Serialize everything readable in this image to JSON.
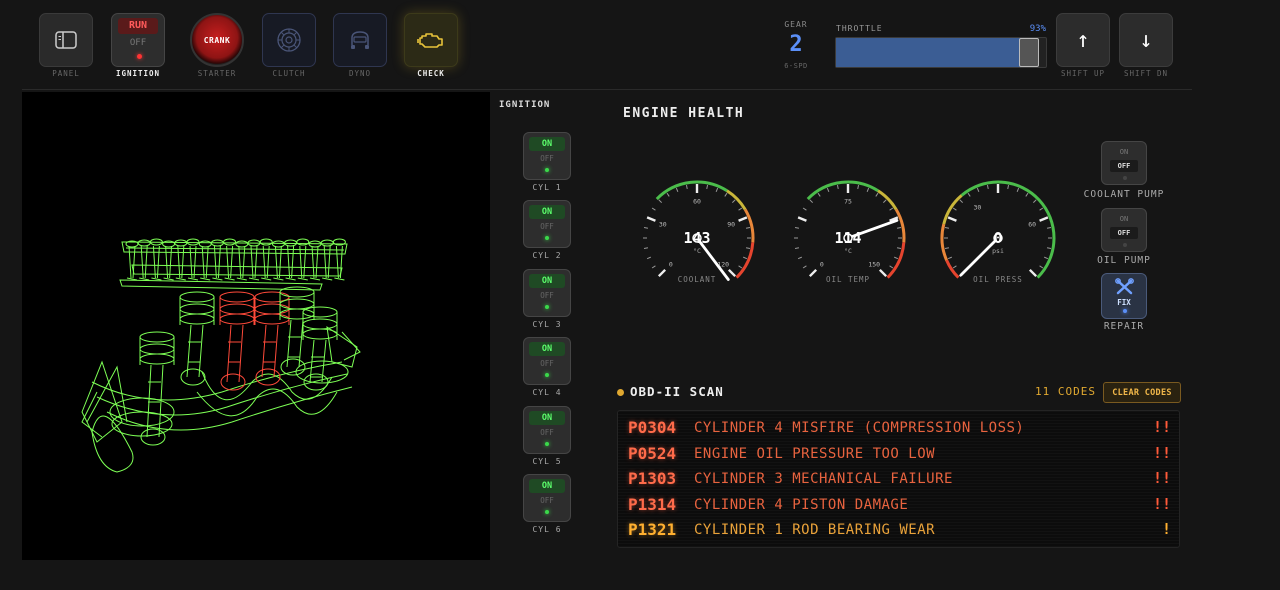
{
  "toolbar": {
    "panel_label": "PANEL",
    "ignition_run": "RUN",
    "ignition_off": "OFF",
    "ignition_label": "IGNITION",
    "starter_text": "CRANK",
    "starter_label": "STARTER",
    "clutch_label": "CLUTCH",
    "dyno_label": "DYNO",
    "check_label": "CHECK"
  },
  "gear": {
    "title": "GEAR",
    "value": "2",
    "sub": "6-SPD"
  },
  "throttle": {
    "label": "THROTTLE",
    "percent_text": "93%",
    "value": 0.93
  },
  "shift": {
    "up_label": "SHIFT UP",
    "down_label": "SHIFT DN"
  },
  "cylinders": {
    "title": "IGNITION",
    "on_text": "ON",
    "off_text": "OFF",
    "labels": [
      "CYL 1",
      "CYL 2",
      "CYL 3",
      "CYL 4",
      "CYL 5",
      "CYL 6"
    ]
  },
  "engine_health": {
    "title": "ENGINE HEALTH",
    "gauges": [
      {
        "label": "COOLANT",
        "value": "143",
        "unit": "°C",
        "reading": 143,
        "min": 0,
        "max": 120,
        "ticks": [
          "0",
          "30",
          "60",
          "90",
          "120"
        ]
      },
      {
        "label": "OIL TEMP",
        "value": "114",
        "unit": "°C",
        "reading": 114,
        "min": 0,
        "max": 150,
        "ticks": [
          "0",
          "75",
          "150"
        ]
      },
      {
        "label": "OIL PRESS",
        "value": "0",
        "unit": "psi",
        "reading": 0,
        "min": 0,
        "max": 80,
        "ticks": [
          "30",
          "60"
        ]
      }
    ]
  },
  "controls": {
    "coolant_pump": {
      "on": "ON",
      "off": "OFF",
      "label": "COOLANT PUMP"
    },
    "oil_pump": {
      "on": "ON",
      "off": "OFF",
      "label": "OIL PUMP"
    },
    "repair": {
      "text": "FIX",
      "label": "REPAIR"
    }
  },
  "obd": {
    "title": "OBD-II SCAN",
    "count": "11 CODES",
    "clear_label": "CLEAR CODES",
    "codes": [
      {
        "id": "P0304",
        "desc": "CYLINDER 4 MISFIRE (COMPRESSION LOSS)",
        "sev": "!!"
      },
      {
        "id": "P0524",
        "desc": "ENGINE OIL PRESSURE TOO LOW",
        "sev": "!!"
      },
      {
        "id": "P1303",
        "desc": "CYLINDER 3 MECHANICAL FAILURE",
        "sev": "!!"
      },
      {
        "id": "P1314",
        "desc": "CYLINDER 4 PISTON DAMAGE",
        "sev": "!!"
      },
      {
        "id": "P1321",
        "desc": "CYLINDER 1 ROD BEARING WEAR",
        "sev": "!"
      }
    ]
  },
  "colors": {
    "accent_blue": "#5b8ff7",
    "alert_red": "#ff5a3a",
    "warn_amber": "#ffb030",
    "ok_green": "#5cff6c",
    "wireframe_green": "#7dff55",
    "wireframe_red": "#ff4a3a"
  }
}
